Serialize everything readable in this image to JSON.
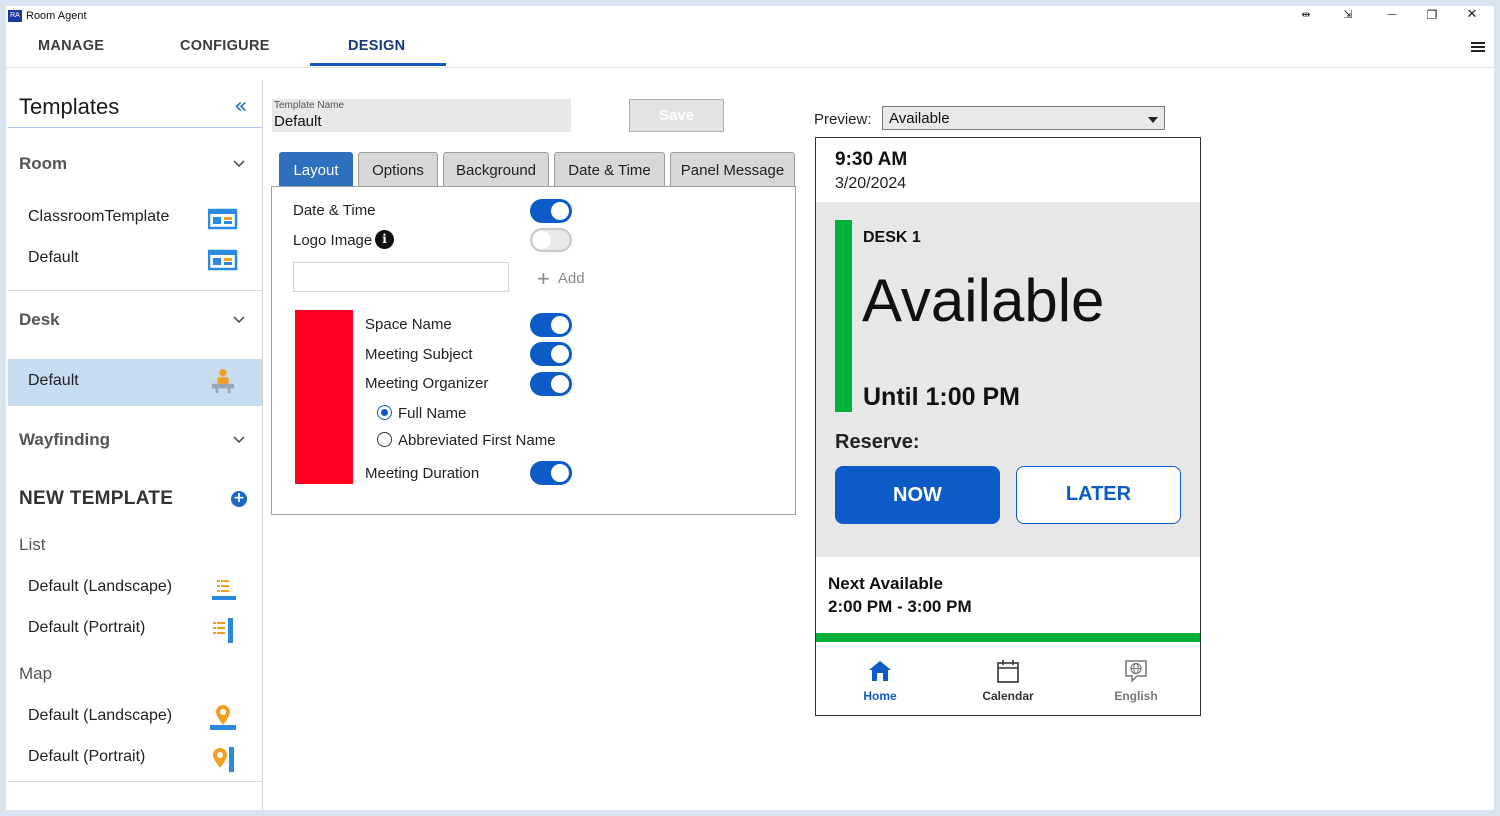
{
  "app": {
    "title": "Room Agent",
    "icon_text": "RA"
  },
  "window_controls": {
    "nav": "⇹",
    "pin": "⇲",
    "minimize": "—",
    "maximize": "❐",
    "close": "✕"
  },
  "nav": {
    "tabs": [
      "MANAGE",
      "CONFIGURE",
      "DESIGN"
    ],
    "active": "DESIGN"
  },
  "sidebar": {
    "title": "Templates",
    "collapse_glyph": "«",
    "sections": {
      "room": {
        "label": "Room",
        "items": [
          "ClassroomTemplate",
          "Default"
        ]
      },
      "desk": {
        "label": "Desk",
        "items": [
          "Default"
        ],
        "selected": "Default"
      },
      "wayfinding": {
        "label": "Wayfinding"
      }
    },
    "new_template": {
      "label": "NEW TEMPLATE",
      "plus": "+",
      "groups": [
        {
          "label": "List",
          "items": [
            "Default (Landscape)",
            "Default (Portrait)"
          ]
        },
        {
          "label": "Map",
          "items": [
            "Default (Landscape)",
            "Default (Portrait)"
          ]
        }
      ]
    }
  },
  "editor": {
    "template_name_label": "Template Name",
    "template_name_value": "Default",
    "save_label": "Save",
    "tabs": [
      "Layout",
      "Options",
      "Background",
      "Date & Time",
      "Panel Message"
    ],
    "active_tab": "Layout",
    "layout": {
      "date_time": {
        "label": "Date & Time",
        "on": true
      },
      "logo_image": {
        "label": "Logo Image",
        "on": false,
        "info_glyph": "i"
      },
      "add_label": "Add",
      "add_plus": "+",
      "block_color": "#ff0020",
      "space_name": {
        "label": "Space Name",
        "on": true
      },
      "meeting_subject": {
        "label": "Meeting Subject",
        "on": true
      },
      "meeting_organizer": {
        "label": "Meeting Organizer",
        "on": true
      },
      "organizer_options": [
        "Full Name",
        "Abbreviated First Name"
      ],
      "organizer_selected": "Full Name",
      "meeting_duration": {
        "label": "Meeting Duration",
        "on": true
      }
    }
  },
  "preview": {
    "label": "Preview:",
    "selected": "Available",
    "panel": {
      "time": "9:30 AM",
      "date": "3/20/2024",
      "space_name": "DESK 1",
      "status": "Available",
      "until": "Until 1:00 PM",
      "reserve_label": "Reserve:",
      "now_label": "NOW",
      "later_label": "LATER",
      "next_available_label": "Next Available",
      "next_available_time": "2:00 PM - 3:00 PM",
      "status_color": "#00b23a",
      "accent_color": "#0d5bc7",
      "footer": [
        {
          "icon": "home-icon",
          "label": "Home"
        },
        {
          "icon": "calendar-icon",
          "label": "Calendar"
        },
        {
          "icon": "language-icon",
          "label": "English"
        }
      ]
    }
  }
}
